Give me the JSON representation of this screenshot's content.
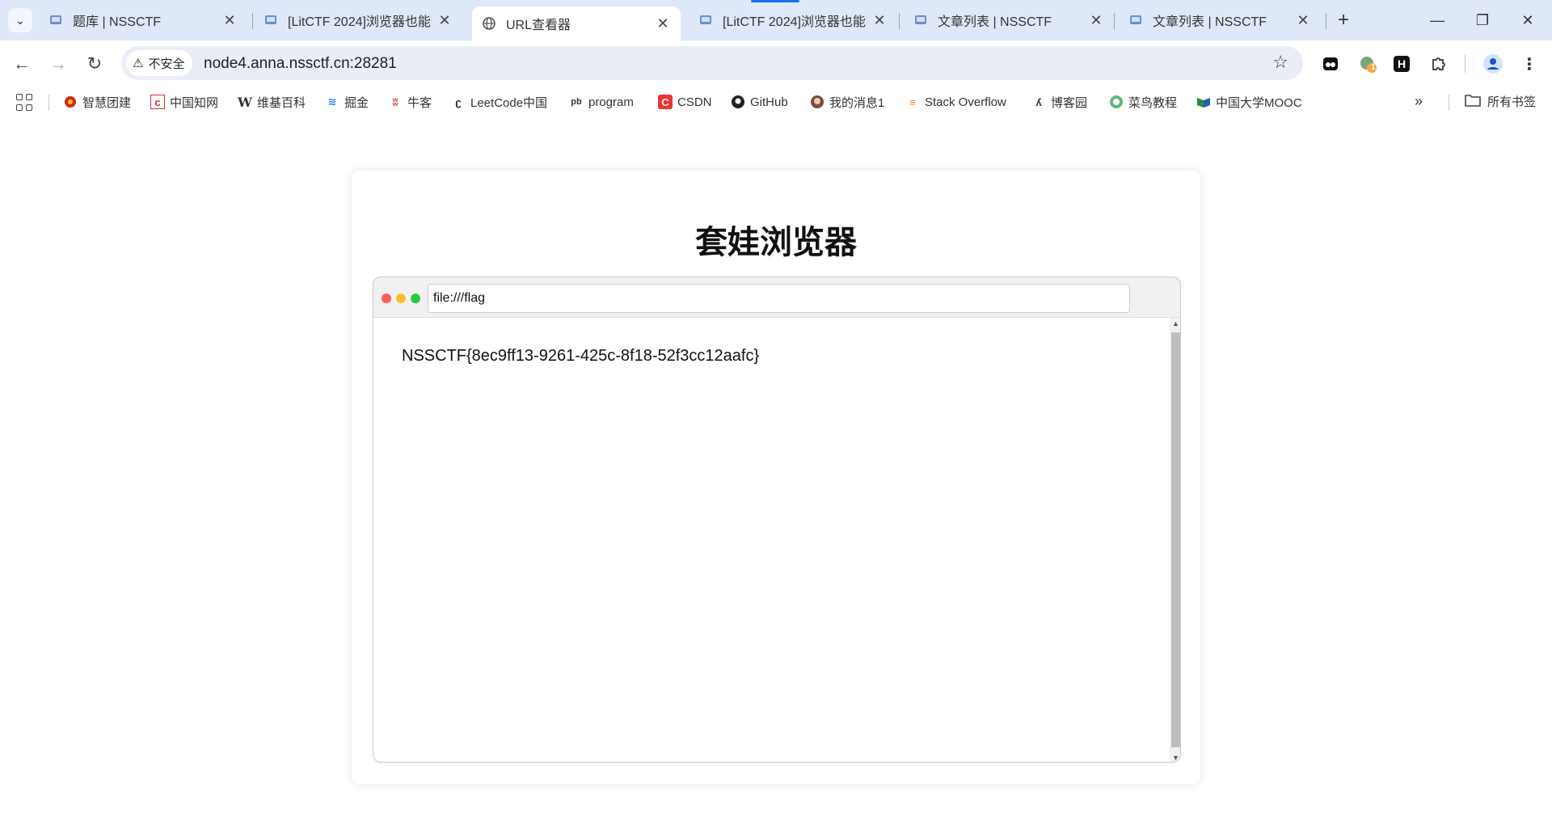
{
  "tabs": [
    {
      "title": "题库 | NSSCTF",
      "icon": "nssctf-icon"
    },
    {
      "title": "[LitCTF 2024]浏览器也能套娃",
      "icon": "nssctf-icon"
    },
    {
      "title": "URL查看器",
      "icon": "globe-icon",
      "active": true
    },
    {
      "title": "[LitCTF 2024]浏览器也能套娃",
      "icon": "nssctf-icon"
    },
    {
      "title": "文章列表 | NSSCTF",
      "icon": "nssctf-icon"
    },
    {
      "title": "文章列表 | NSSCTF",
      "icon": "nssctf-icon"
    }
  ],
  "tab_close": "✕",
  "new_tab": "+",
  "window_controls": {
    "minimize": "—",
    "restore": "❐",
    "close": "✕"
  },
  "toolbar": {
    "back": "←",
    "forward": "→",
    "reload": "↻",
    "security_label": "不安全",
    "url": "node4.anna.nssctf.cn:28281",
    "extension_badge": "1",
    "ext_h": "H"
  },
  "bookmarks": [
    {
      "label": "智慧团建"
    },
    {
      "label": "中国知网"
    },
    {
      "label": "维基百科"
    },
    {
      "label": "掘金"
    },
    {
      "label": "牛客"
    },
    {
      "label": "LeetCode中国"
    },
    {
      "label": "program"
    },
    {
      "label": "CSDN"
    },
    {
      "label": "GitHub"
    },
    {
      "label": "我的消息1"
    },
    {
      "label": "Stack Overflow"
    },
    {
      "label": "博客园"
    },
    {
      "label": "菜鸟教程"
    },
    {
      "label": "中国大学MOOC"
    }
  ],
  "bookmarks_more": "»",
  "all_bookmarks": "所有书签",
  "page": {
    "title": "套娃浏览器",
    "inner_url": "file:///flag",
    "content": "NSSCTF{8ec9ff13-9261-425c-8f18-52f3cc12aafc}"
  },
  "colors": {
    "tabstrip": "#dfe8f8",
    "dot_red": "#ff5f57",
    "dot_yellow": "#febc2e",
    "dot_green": "#28c840"
  }
}
